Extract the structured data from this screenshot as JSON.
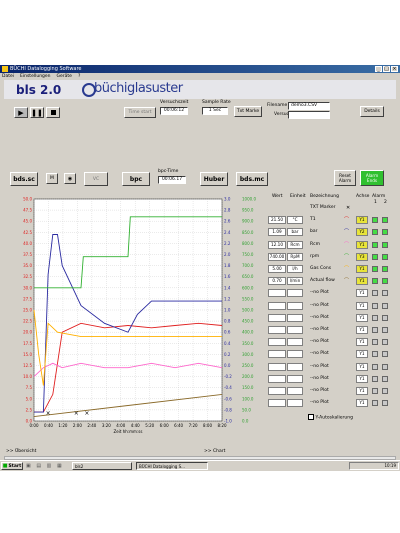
{
  "window": {
    "title": "BÜCHI Datalogging Software"
  },
  "menu": [
    "Datei",
    "Einstellungen",
    "Geräte",
    "?"
  ],
  "header": {
    "product": "bls 2.0",
    "brand": "büchiglasuster"
  },
  "controls": {
    "time_start_label": "Time start",
    "versuchszeit_label": "Versuchszeit",
    "versuchszeit_value": "00:06:12",
    "sample_rate_label": "Sample Rate",
    "sample_rate_value": "1 Sec",
    "txt_marke_label": "Txt Marke",
    "filename_label": "Filename",
    "filename_value": "demo3.CSV",
    "versuch_label": "Versuch",
    "versuch_value": "",
    "details_label": "Details"
  },
  "devices": {
    "bds_sc": "bds.sc",
    "m": "M",
    "vc": "VC",
    "bpc": "bpc",
    "bpc_time_label": "bpc-Time",
    "bpc_time_value": "00:06.17",
    "huber": "Huber",
    "bds_mc": "bds.mc",
    "reset_alarm": "Reset Alarm",
    "alarm_ends": "Alarm Ends"
  },
  "chart_data": {
    "type": "line",
    "xlabel": "Zeit hh:mm:ss",
    "x_ticks": [
      "0:00",
      "0:40",
      "1:20",
      "2:00",
      "2:40",
      "3:20",
      "4:00",
      "4:40",
      "5:20",
      "6:00",
      "6:40",
      "7:20",
      "8:00",
      "8:20"
    ],
    "y_left_ticks": [
      "50.0",
      "47.5",
      "45.0",
      "42.5",
      "40.0",
      "37.5",
      "35.0",
      "32.5",
      "30.0",
      "27.5",
      "25.0",
      "22.5",
      "20.0",
      "17.5",
      "15.0",
      "12.5",
      "10.0",
      "7.5",
      "5.0",
      "2.5",
      "0.0"
    ],
    "y_right1_ticks": [
      "3.0",
      "2.8",
      "2.6",
      "2.4",
      "2.2",
      "2.0",
      "1.8",
      "1.6",
      "1.4",
      "1.2",
      "1.0",
      "0.8",
      "0.6",
      "0.4",
      "0.2",
      "0.0",
      "-0.2",
      "-0.4",
      "-0.6",
      "-0.8",
      "-1.0"
    ],
    "y_right2_ticks": [
      "1000.0",
      "950.0",
      "900.0",
      "850.0",
      "800.0",
      "750.0",
      "700.0",
      "650.0",
      "600.0",
      "550.0",
      "500.0",
      "450.0",
      "400.0",
      "350.0",
      "300.0",
      "250.0",
      "200.0",
      "150.0",
      "100.0",
      "50.0",
      "0.0"
    ],
    "series": [
      {
        "name": "T1",
        "color": "#e02020",
        "x": [
          0,
          40,
          80,
          120,
          200,
          300,
          400,
          500,
          600,
          700,
          800
        ],
        "y": [
          2,
          2,
          6,
          20,
          22,
          21,
          21.5,
          21,
          21.5,
          22,
          21.5
        ]
      },
      {
        "name": "bar",
        "color": "#2a2aa0",
        "x": [
          0,
          40,
          60,
          80,
          100,
          120,
          200,
          300,
          400,
          440,
          500,
          600,
          700,
          800
        ],
        "y": [
          2,
          2,
          33,
          42,
          42,
          35,
          26,
          22,
          20,
          24,
          27,
          27,
          27,
          27
        ]
      },
      {
        "name": "Rcm",
        "color": "#ff66cc",
        "x": [
          0,
          40,
          80,
          120,
          200,
          300,
          400,
          500,
          600,
          700,
          800
        ],
        "y": [
          10,
          12,
          13,
          12,
          13,
          12,
          12,
          13,
          12,
          13,
          12
        ]
      },
      {
        "name": "rpm",
        "color": "#30b030",
        "x": [
          0,
          200,
          210,
          400,
          410,
          800
        ],
        "y": [
          30,
          30,
          37,
          37,
          46,
          46
        ]
      },
      {
        "name": "Gas Cons",
        "color": "#ffb000",
        "x": [
          0,
          20,
          40,
          60,
          100,
          200,
          300,
          400,
          500,
          600,
          700,
          800
        ],
        "y": [
          25,
          15,
          8,
          22,
          20,
          19,
          19,
          19,
          19,
          19,
          19,
          19
        ]
      },
      {
        "name": "Actual flow",
        "color": "#8a6a2a",
        "x": [
          0,
          800
        ],
        "y": [
          1,
          6
        ]
      }
    ]
  },
  "tabs": {
    "uebersicht": ">> Übersicht",
    "chart": ">> Chart"
  },
  "table": {
    "headers": {
      "wert": "Wert",
      "einheit": "Einheit",
      "bezeichnung": "Bezeichnung",
      "achse": "Achse",
      "alarm": "Alarm",
      "alarm1": "1",
      "alarm2": "2"
    },
    "rows": [
      {
        "wert": "",
        "einheit": "",
        "name": "TXT Marker",
        "achse": ""
      },
      {
        "wert": "21.50",
        "einheit": "°C",
        "name": "T1",
        "achse": "Y1"
      },
      {
        "wert": "1.09",
        "einheit": "bar",
        "name": "bar",
        "achse": "Y2"
      },
      {
        "wert": "12.10",
        "einheit": "Rcm",
        "name": "Rcm",
        "achse": "Y1"
      },
      {
        "wert": "740.00",
        "einheit": "RpM",
        "name": "rpm",
        "achse": "Y3"
      },
      {
        "wert": "5.00",
        "einheit": "l/h",
        "name": "Gas Cons",
        "achse": "Y1"
      },
      {
        "wert": "0.70",
        "einheit": "l/min",
        "name": "Actual flow",
        "achse": "Y1"
      },
      {
        "wert": "",
        "einheit": "",
        "name": "--no Plot",
        "achse": "Y1"
      },
      {
        "wert": "",
        "einheit": "",
        "name": "--no Plot",
        "achse": "Y1"
      },
      {
        "wert": "",
        "einheit": "",
        "name": "--no Plot",
        "achse": "Y1"
      },
      {
        "wert": "",
        "einheit": "",
        "name": "--no Plot",
        "achse": "Y1"
      },
      {
        "wert": "",
        "einheit": "",
        "name": "--no Plot",
        "achse": "Y1"
      },
      {
        "wert": "",
        "einheit": "",
        "name": "--no Plot",
        "achse": "Y1"
      },
      {
        "wert": "",
        "einheit": "",
        "name": "--no Plot",
        "achse": "Y1"
      },
      {
        "wert": "",
        "einheit": "",
        "name": "--no Plot",
        "achse": "Y1"
      },
      {
        "wert": "",
        "einheit": "",
        "name": "--no Plot",
        "achse": "Y1"
      },
      {
        "wert": "",
        "einheit": "",
        "name": "--no Plot",
        "achse": "Y1"
      }
    ],
    "autoscale_label": "Y-Autoskalierung"
  },
  "taskbar": {
    "start": "Start",
    "items": [
      "bls2",
      "BÜCHI Datalogging S..."
    ],
    "clock": "10:19"
  }
}
